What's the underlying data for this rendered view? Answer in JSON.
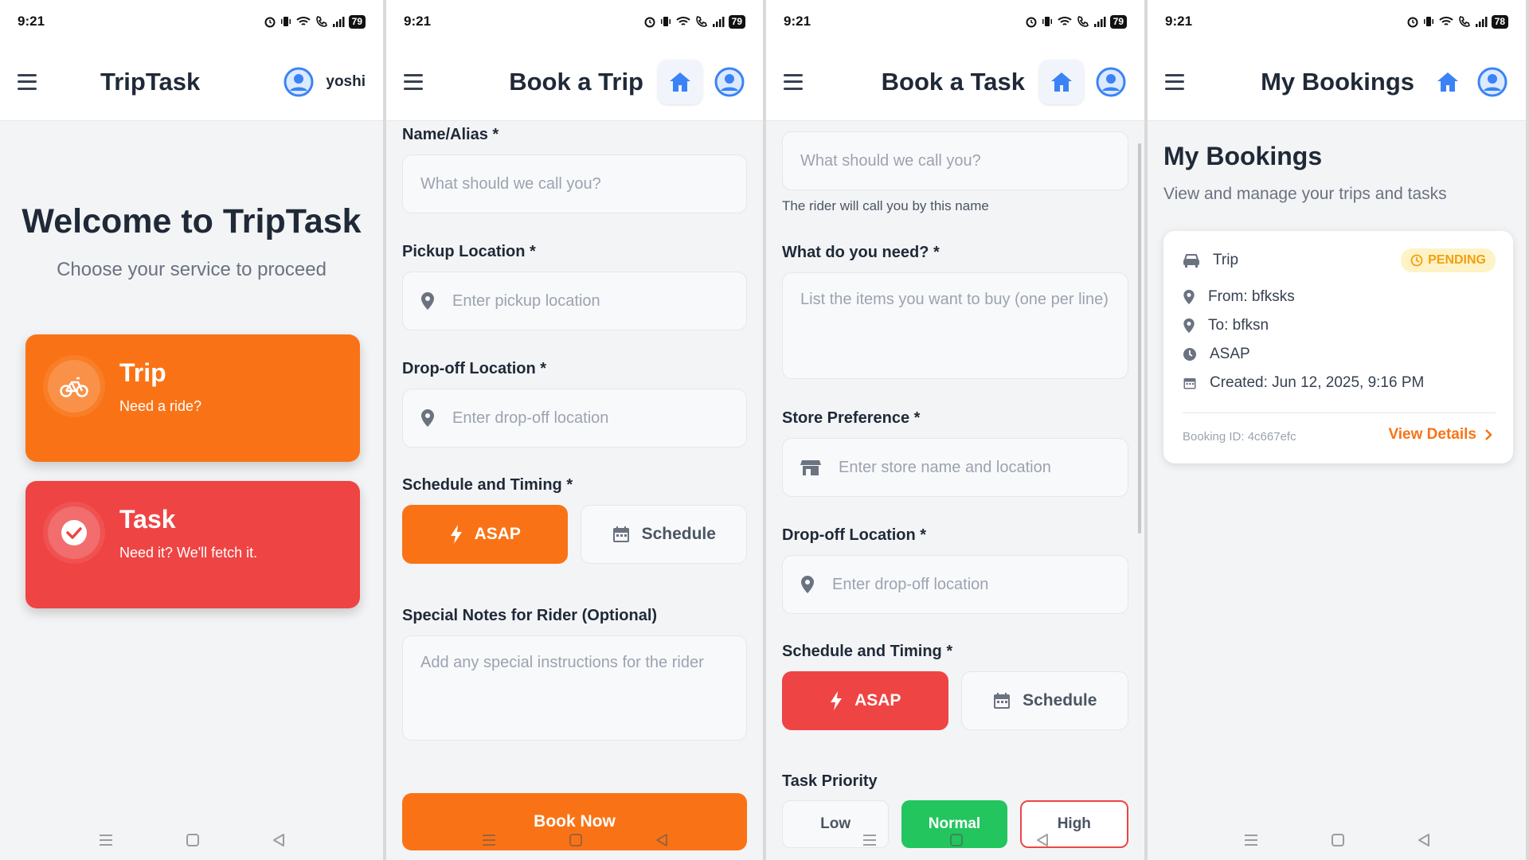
{
  "status": {
    "time": "9:21",
    "battery_1": "79",
    "battery_2": "79",
    "battery_3": "79",
    "battery_4": "78"
  },
  "colors": {
    "orange": "#f97316",
    "red": "#ef4444",
    "green": "#22c55e",
    "blue": "#3b82f6"
  },
  "screen1": {
    "title": "TripTask",
    "username": "yoshi",
    "welcome_title": "Welcome to TripTask",
    "welcome_subtitle": "Choose your service to proceed",
    "trip_card": {
      "title": "Trip",
      "subtitle": "Need a ride?",
      "icon": "bike-icon"
    },
    "task_card": {
      "title": "Task",
      "subtitle": "Need it? We'll fetch it.",
      "icon": "check-circle-icon"
    }
  },
  "screen2": {
    "title": "Book a Trip",
    "name_label": "Name/Alias *",
    "name_placeholder": "What should we call you?",
    "pickup_label": "Pickup Location *",
    "pickup_placeholder": "Enter pickup location",
    "dropoff_label": "Drop-off Location *",
    "dropoff_placeholder": "Enter drop-off location",
    "schedule_label": "Schedule and Timing *",
    "asap_label": "ASAP",
    "schedule_button": "Schedule",
    "notes_label": "Special Notes for Rider (Optional)",
    "notes_placeholder": "Add any special instructions for the rider",
    "submit_label": "Book Now"
  },
  "screen3": {
    "title": "Book a Task",
    "name_placeholder": "What should we call you?",
    "name_hint": "The rider will call you by this name",
    "need_label": "What do you need? *",
    "need_placeholder": "List the items you want to buy (one per line)",
    "store_label": "Store Preference *",
    "store_placeholder": "Enter store name and location",
    "dropoff_label": "Drop-off Location *",
    "dropoff_placeholder": "Enter drop-off location",
    "schedule_label": "Schedule and Timing *",
    "asap_label": "ASAP",
    "schedule_button": "Schedule",
    "priority_label": "Task Priority",
    "priority_low": "Low",
    "priority_normal": "Normal",
    "priority_high": "High"
  },
  "screen4": {
    "title": "My Bookings",
    "heading": "My Bookings",
    "subheading": "View and manage your trips and tasks",
    "booking": {
      "type": "Trip",
      "status": "PENDING",
      "from": "From: bfksks",
      "to": "To: bfksn",
      "timing": "ASAP",
      "created": "Created: Jun 12, 2025, 9:16 PM",
      "booking_id": "Booking ID: 4c667efc",
      "view_details": "View Details"
    }
  }
}
